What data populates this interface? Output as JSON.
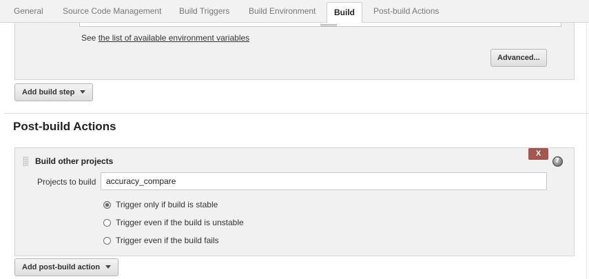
{
  "tabs": [
    {
      "label": "General",
      "active": false
    },
    {
      "label": "Source Code Management",
      "active": false
    },
    {
      "label": "Build Triggers",
      "active": false
    },
    {
      "label": "Build Environment",
      "active": false
    },
    {
      "label": "Build",
      "active": true
    },
    {
      "label": "Post-build Actions",
      "active": false
    }
  ],
  "build": {
    "env_prefix": "See",
    "env_link": "the list of available environment variables",
    "advanced_label": "Advanced...",
    "add_build_step_label": "Add build step"
  },
  "post_build": {
    "section_title": "Post-build Actions",
    "step_title": "Build other projects",
    "delete_label": "X",
    "projects_label": "Projects to build",
    "projects_value": "accuracy_compare",
    "options": [
      {
        "label": "Trigger only if build is stable",
        "checked": true
      },
      {
        "label": "Trigger even if the build is unstable",
        "checked": false
      },
      {
        "label": "Trigger even if the build fails",
        "checked": false
      }
    ],
    "add_action_label": "Add post-build action"
  },
  "icons": {
    "help": "help-icon",
    "drag": "drag-handle-icon",
    "caret": "caret-down-icon"
  }
}
